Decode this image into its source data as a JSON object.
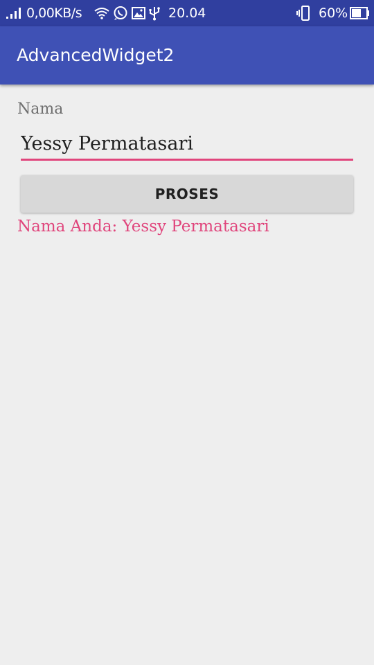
{
  "status_bar": {
    "net_speed": "0,00KB/s",
    "time": "20.04",
    "battery": "60%",
    "icons": [
      "signal-icon",
      "wifi-icon",
      "whatsapp-icon",
      "gallery-icon",
      "usb-icon",
      "vibrate-icon",
      "battery-icon"
    ]
  },
  "app_bar": {
    "title": "AdvancedWidget2",
    "color": "#3f51b5"
  },
  "form": {
    "label": "Nama",
    "input_value": "Yessy Permatasari",
    "button_label": "PROSES",
    "result": "Nama Anda: Yessy Permatasari",
    "accent_color": "#e0457c"
  }
}
